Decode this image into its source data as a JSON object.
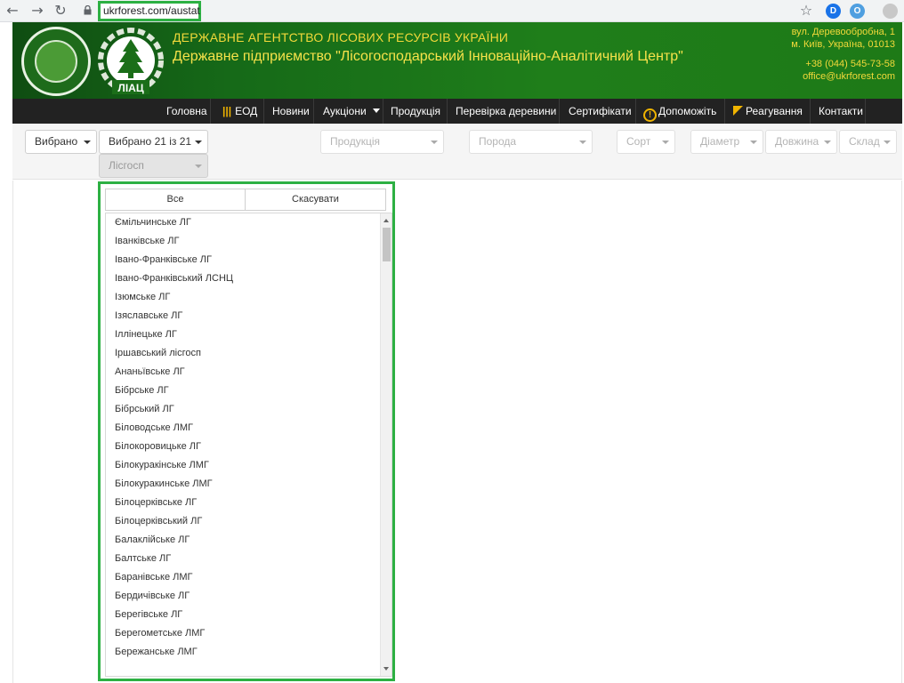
{
  "browser": {
    "url": "ukrforest.com/austat",
    "back_icon": "←",
    "forward_icon": "→",
    "reload_icon": "↻",
    "star_icon": "☆"
  },
  "header": {
    "agency": "ДЕРЖАВНЕ АГЕНТСТВО ЛІСОВИХ РЕСУРСІВ УКРАЇНИ",
    "company": "Державне підприємство \"Лісогосподарський Інноваційно-Аналітичний Центр\"",
    "address_line1": "вул. Деревообробна, 1",
    "address_line2": "м. Київ, Україна, 01013",
    "phone": "+38 (044) 545-73-58",
    "email": "office@ukrforest.com",
    "logo_text": "ЛІАЦ"
  },
  "nav": {
    "items": [
      {
        "label": "Головна"
      },
      {
        "label": "ЕОД"
      },
      {
        "label": "Новини"
      },
      {
        "label": "Аукціони"
      },
      {
        "label": "Продукція"
      },
      {
        "label": "Перевірка деревини"
      },
      {
        "label": "Сертифікати"
      },
      {
        "label": "Допоможіть"
      },
      {
        "label": "Реагування"
      },
      {
        "label": "Контакти"
      }
    ]
  },
  "filters": {
    "first": "Вибрано",
    "second": "Вибрано 21 із 21",
    "lisgosp": "Лісгосп",
    "produktsiia": "Продукція",
    "poroda": "Порода",
    "sort": "Сорт",
    "diametr": "Діаметр",
    "dovzhyna": "Довжина",
    "sklad": "Склад"
  },
  "dropdown": {
    "select_all": "Все",
    "cancel": "Скасувати",
    "items": [
      "Ємільчинське ЛГ",
      "Іванківське ЛГ",
      "Івано-Франківське ЛГ",
      "Івано-Франківський ЛСНЦ",
      "Ізюмське ЛГ",
      "Ізяславське ЛГ",
      "Іллінецьке ЛГ",
      "Іршавський лісгосп",
      "Ананьївське ЛГ",
      "Бібрське ЛГ",
      "Бібрський ЛГ",
      "Біловодське ЛМГ",
      "Білокоровицьке ЛГ",
      "Білокуракінське ЛМГ",
      "Білокуракинське ЛМГ",
      "Білоцерківське ЛГ",
      "Білоцерківський ЛГ",
      "Балаклійське ЛГ",
      "Балтське ЛГ",
      "Баранівське ЛМГ",
      "Бердичівське ЛГ",
      "Берегівське ЛГ",
      "Берегометське ЛМГ",
      "Бережанське ЛМГ"
    ]
  },
  "colors": {
    "highlight": "#2db043",
    "header_green": "#1f7e1a",
    "header_text": "#f2d93a",
    "nav_bg": "#222222"
  }
}
